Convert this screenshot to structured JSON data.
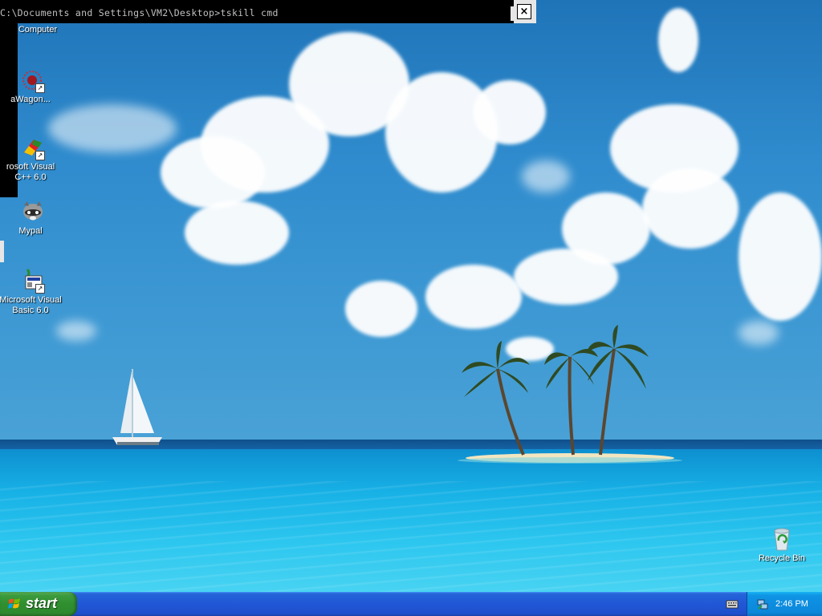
{
  "console": {
    "command_line": "C:\\Documents and Settings\\VM2\\Desktop>tskill cmd",
    "close_label": "×"
  },
  "desktop": {
    "icons": [
      {
        "label": "Computer"
      },
      {
        "label": "aWagon..."
      },
      {
        "label_line1": "rosoft Visual",
        "label_line2": "C++ 6.0"
      },
      {
        "label": "Mypal"
      },
      {
        "label_line1": "Microsoft Visual",
        "label_line2": "Basic 6.0"
      }
    ],
    "recycle_bin": {
      "label": "Recycle Bin"
    }
  },
  "taskbar": {
    "start_label": "start",
    "clock": "2:46 PM"
  },
  "colors": {
    "taskbar_blue": "#2157d6",
    "start_green": "#2f8f2f",
    "tray_blue": "#0d8de0"
  }
}
